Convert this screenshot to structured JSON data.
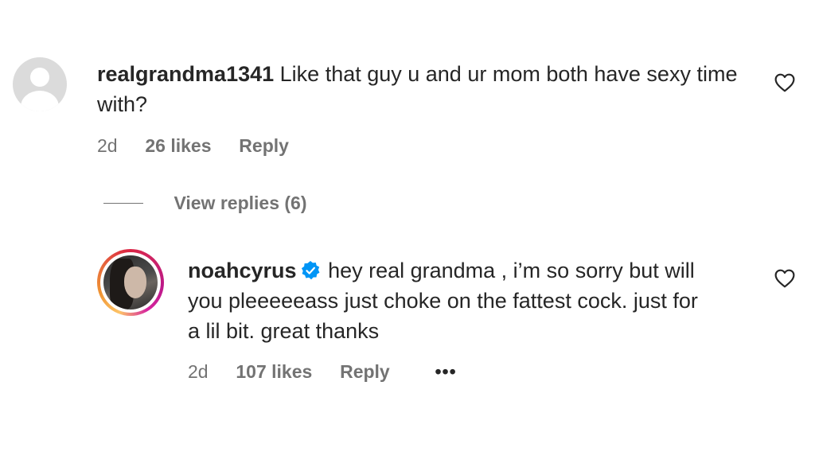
{
  "comments": [
    {
      "username": "realgrandma1341",
      "text": "Like that guy u and ur mom both have sexy time with?",
      "time": "2d",
      "likes": "26 likes",
      "reply_label": "Reply",
      "view_replies_label": "View replies (6)"
    },
    {
      "username": "noahcyrus",
      "verified": true,
      "text_line1": "hey real grandma , i’m so sorry but will",
      "text_line2": "you pleeeeeass just choke on the fattest cock. just for",
      "text_line3": "a lil bit. great thanks",
      "time": "2d",
      "likes": "107 likes",
      "reply_label": "Reply",
      "more_label": "•••"
    }
  ],
  "icons": {
    "like": "heart-outline-icon",
    "verified": "verified-badge-icon",
    "more": "more-options-icon",
    "avatar_default": "default-avatar-icon"
  },
  "colors": {
    "text_primary": "#262626",
    "text_secondary": "#737373",
    "verified_blue": "#0095f6",
    "avatar_placeholder": "#dbdbdb"
  }
}
